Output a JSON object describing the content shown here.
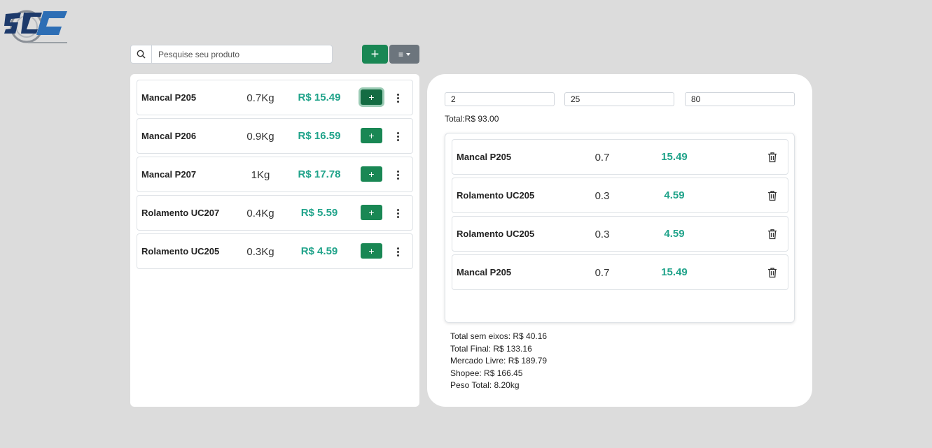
{
  "search": {
    "placeholder": "Pesquise seu produto"
  },
  "toolbar": {
    "add_label": "+",
    "menu_label": "≡"
  },
  "products": [
    {
      "name": "Mancal P205",
      "weight": "0.7Kg",
      "price": "R$ 15.49",
      "add": "+"
    },
    {
      "name": "Mancal P206",
      "weight": "0.9Kg",
      "price": "R$ 16.59",
      "add": "+"
    },
    {
      "name": "Mancal P207",
      "weight": "1Kg",
      "price": "R$ 17.78",
      "add": "+"
    },
    {
      "name": "Rolamento UC207",
      "weight": "0.4Kg",
      "price": "R$ 5.59",
      "add": "+"
    },
    {
      "name": "Rolamento UC205",
      "weight": "0.3Kg",
      "price": "R$ 4.59",
      "add": "+"
    }
  ],
  "calc": {
    "input1": "2",
    "input2": "25",
    "input3": "80",
    "total": "Total:R$ 93.00"
  },
  "cart": [
    {
      "name": "Mancal P205",
      "weight": "0.7",
      "price": "15.49"
    },
    {
      "name": "Rolamento UC205",
      "weight": "0.3",
      "price": "4.59"
    },
    {
      "name": "Rolamento UC205",
      "weight": "0.3",
      "price": "4.59"
    },
    {
      "name": "Mancal P205",
      "weight": "0.7",
      "price": "15.49"
    }
  ],
  "summary": {
    "sem_eixos": "Total sem eixos: R$ 40.16",
    "final": "Total Final: R$ 133.16",
    "mercado_livre": "Mercado Livre: R$ 189.79",
    "shopee": "Shopee: R$ 166.45",
    "peso": "Peso Total: 8.20kg"
  },
  "colors": {
    "accent_green": "#198754",
    "price_teal": "#20a38a",
    "menu_gray": "#6c757d",
    "logo_navy": "#1d3a6b",
    "logo_blue": "#2d6eb5"
  }
}
